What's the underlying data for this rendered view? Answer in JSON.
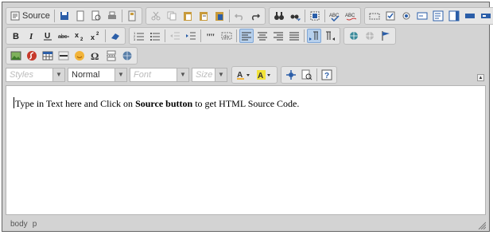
{
  "toolbar": {
    "source_label": "Source",
    "styles_placeholder": "Styles",
    "format_value": "Normal",
    "font_placeholder": "Font",
    "size_placeholder": "Size"
  },
  "editor": {
    "text_before": "Type in Text here and Click on ",
    "text_bold": "Source button",
    "text_after": " to get HTML Source Code."
  },
  "status": {
    "path": [
      "body",
      "p"
    ]
  },
  "colors": {
    "frame_bg": "#d3d3d3",
    "active_button": "#b7d0ec",
    "icon_blue": "#2b5ea8"
  }
}
